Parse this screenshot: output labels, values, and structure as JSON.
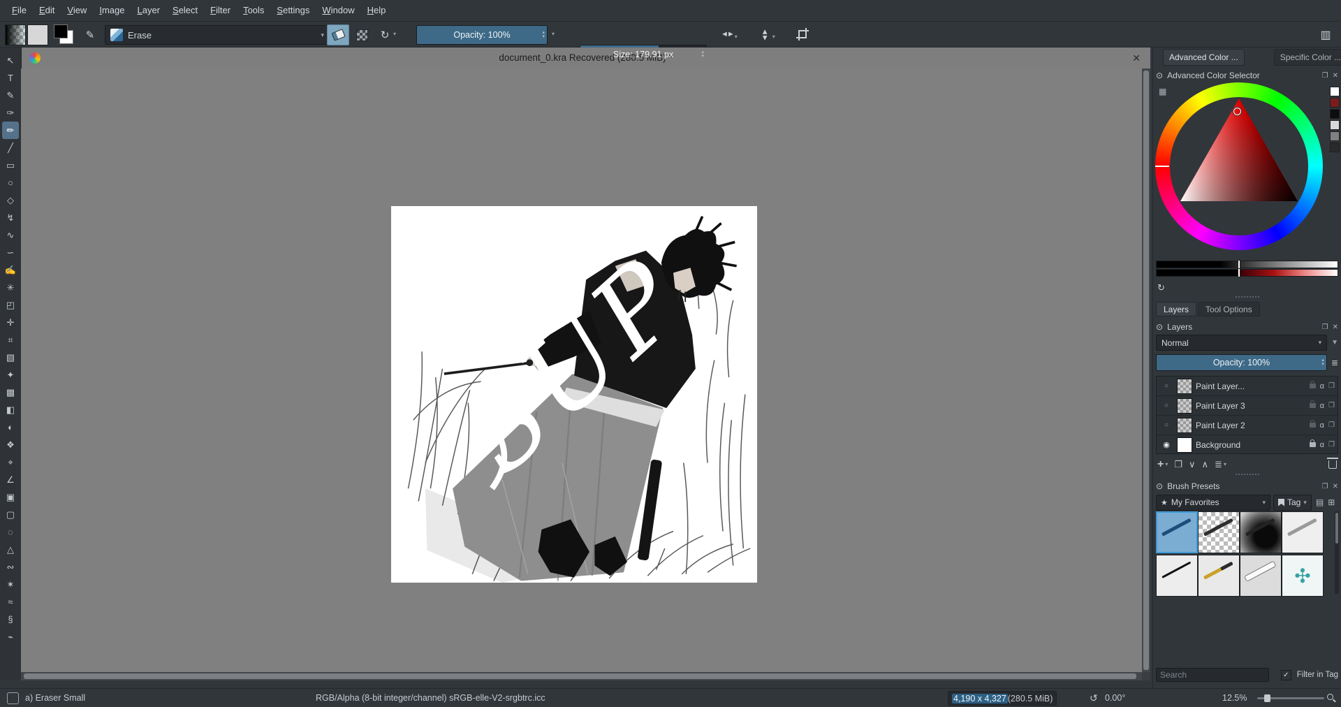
{
  "menubar": {
    "items": [
      "File",
      "Edit",
      "View",
      "Image",
      "Layer",
      "Select",
      "Filter",
      "Tools",
      "Settings",
      "Window",
      "Help"
    ]
  },
  "toolbar": {
    "preset_name": "Erase",
    "opacity_label": "Opacity: 100%",
    "size_label": "Size: 179.91 px"
  },
  "icons": {
    "dropdown": "▾",
    "spin_up": "▴",
    "spin_down": "▾",
    "reload": "↻",
    "workspace": "▥",
    "docker": "⊙",
    "float": "❐",
    "close": "✕",
    "mini_grid": "▦",
    "filter": "▼",
    "menu_lines": "≣",
    "star": "★",
    "view_mode": "▤",
    "grid_small": "⊞",
    "plus": "+",
    "duplicate": "❐",
    "arrow_down": "∨",
    "arrow_up": "∧",
    "properties": "≣",
    "alpha": "α",
    "check": "✓",
    "mirror_pair": "◄►",
    "rotate_canvas": "↺",
    "brush_editor": "✎"
  },
  "toolbox": {
    "tools": [
      {
        "name": "tool-select-shapes",
        "glyph": "↖"
      },
      {
        "name": "tool-text",
        "glyph": "T"
      },
      {
        "name": "tool-edit-shapes",
        "glyph": "✎"
      },
      {
        "name": "tool-calligraphy",
        "glyph": "✑"
      },
      {
        "name": "tool-freehand-brush",
        "glyph": "✏",
        "selected": true
      },
      {
        "name": "tool-line",
        "glyph": "╱"
      },
      {
        "name": "tool-rectangle",
        "glyph": "▭"
      },
      {
        "name": "tool-ellipse",
        "glyph": "○"
      },
      {
        "name": "tool-polygon",
        "glyph": "◇"
      },
      {
        "name": "tool-polyline",
        "glyph": "↯"
      },
      {
        "name": "tool-bezier-curve",
        "glyph": "∿"
      },
      {
        "name": "tool-freehand-path",
        "glyph": "∽"
      },
      {
        "name": "tool-dynamic-brush",
        "glyph": "✍"
      },
      {
        "name": "tool-multibrush",
        "glyph": "✳"
      },
      {
        "name": "tool-transform",
        "glyph": "◰"
      },
      {
        "name": "tool-move",
        "glyph": "✛"
      },
      {
        "name": "tool-crop",
        "glyph": "⌗"
      },
      {
        "name": "tool-gradient",
        "glyph": "▧"
      },
      {
        "name": "tool-color-sampler",
        "glyph": "✦"
      },
      {
        "name": "tool-pattern-edit",
        "glyph": "▩"
      },
      {
        "name": "tool-fill",
        "glyph": "◧"
      },
      {
        "name": "tool-enclose-fill",
        "glyph": "◐"
      },
      {
        "name": "tool-smart-patch",
        "glyph": "❖"
      },
      {
        "name": "tool-assistants",
        "glyph": "⌖"
      },
      {
        "name": "tool-measure",
        "glyph": "∠"
      },
      {
        "name": "tool-reference-images",
        "glyph": "▣"
      },
      {
        "name": "tool-rect-select",
        "glyph": "▢"
      },
      {
        "name": "tool-ellipse-select",
        "glyph": "◌"
      },
      {
        "name": "tool-polygon-select",
        "glyph": "△"
      },
      {
        "name": "tool-freehand-select",
        "glyph": "∾"
      },
      {
        "name": "tool-contiguous-select",
        "glyph": "✶"
      },
      {
        "name": "tool-similar-select",
        "glyph": "≈"
      },
      {
        "name": "tool-bezier-select",
        "glyph": "§"
      },
      {
        "name": "tool-magnetic-select",
        "glyph": "⌁"
      }
    ]
  },
  "document": {
    "title": "document_0.kra Recovered (280.5 MiB) *"
  },
  "canvas": {
    "overlay_text": "SUP"
  },
  "right_panel": {
    "top_tabs": [
      {
        "label": "Advanced Color ...",
        "active": true
      },
      {
        "label": "Specific Color ...",
        "active": false
      }
    ],
    "advanced_color": {
      "title": "Advanced Color Selector",
      "history_colors": [
        "#ffffff",
        "#7a1c1c",
        "#0d0d0d",
        "#d9d9d9",
        "#808080",
        "#2a2a2a"
      ]
    },
    "docker_tabs": [
      {
        "label": "Layers",
        "active": true
      },
      {
        "label": "Tool Options",
        "active": false
      }
    ],
    "layers": {
      "title": "Layers",
      "blend_mode": "Normal",
      "opacity_label": "Opacity:  100%",
      "rows": [
        {
          "name": "Paint Layer...",
          "visible": false,
          "white": false,
          "locked": false
        },
        {
          "name": "Paint Layer 3",
          "visible": false,
          "white": false,
          "locked": false
        },
        {
          "name": "Paint Layer 2",
          "visible": false,
          "white": false,
          "locked": false
        },
        {
          "name": "Background",
          "visible": true,
          "white": true,
          "locked": true
        }
      ]
    },
    "brush_presets": {
      "title": "Brush Presets",
      "favorites_label": "My Favorites",
      "tag_label": "Tag",
      "search_placeholder": "Search",
      "filter_label": "Filter in Tag",
      "cells": [
        {
          "kind": "pencil-blue",
          "selected": true
        },
        {
          "kind": "eraser-checker"
        },
        {
          "kind": "airbrush-dark"
        },
        {
          "kind": "pencil-light"
        },
        {
          "kind": "ink-pen"
        },
        {
          "kind": "fountain-yellow"
        },
        {
          "kind": "round-white"
        },
        {
          "kind": "stamp-teal"
        }
      ]
    }
  },
  "statusbar": {
    "tool_label": "a) Eraser Small",
    "color_profile": "RGB/Alpha (8-bit integer/channel)  sRGB-elle-V2-srgbtrc.icc",
    "dimensions_selected": "4,190 x 4,327",
    "dimensions_rest": " (280.5 MiB)",
    "rotation": "0.00°",
    "zoom": "12.5%"
  }
}
